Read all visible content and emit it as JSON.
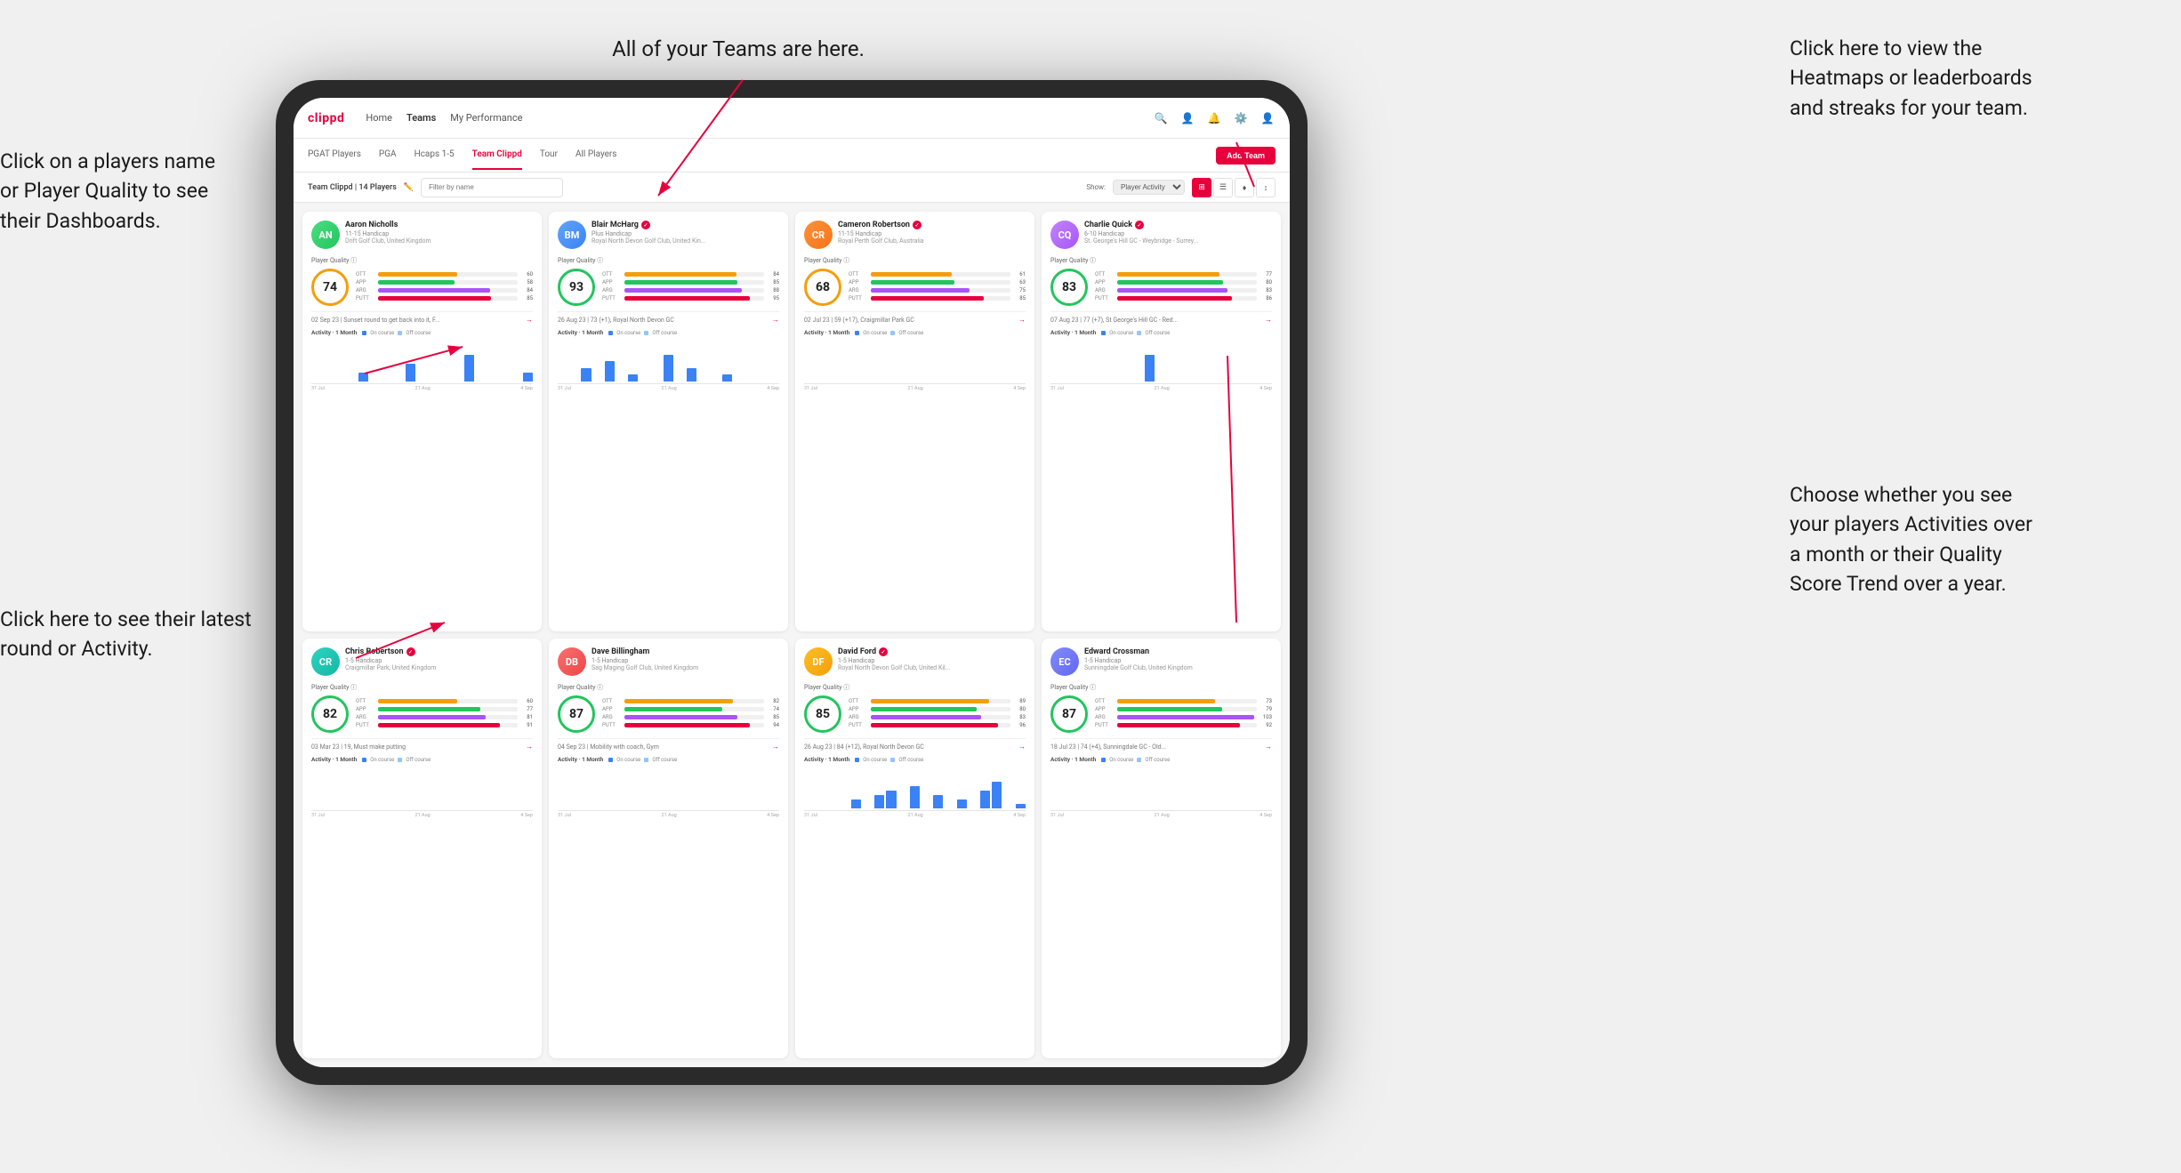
{
  "annotations": {
    "top_left": "Click on a players name\nor Player Quality to see\ntheir Dashboards.",
    "bottom_left": "Click here to see their latest\nround or Activity.",
    "top_center": "All of your Teams are here.",
    "top_right": "Click here to view the\nHeatmaps or leaderboards\nand streaks for your team.",
    "bottom_right": "Choose whether you see\nyour players Activities over\na month or their Quality\nScore Trend over a year."
  },
  "app": {
    "logo": "clippd",
    "nav": [
      "Home",
      "Teams",
      "My Performance"
    ],
    "tabs": [
      "PGAT Players",
      "PGA",
      "Hcaps 1-5",
      "Team Clippd",
      "Tour",
      "All Players"
    ],
    "active_tab": "Team Clippd",
    "team_label": "Team Clippd | 14 Players",
    "search_placeholder": "Filter by name",
    "show_label": "Show:",
    "show_option": "Player Activity",
    "add_team": "Add Team"
  },
  "players": [
    {
      "name": "Aaron Nicholls",
      "handicap": "11-15 Handicap",
      "club": "Drift Golf Club, United Kingdom",
      "quality": 74,
      "quality_level": "mid",
      "ott": 60,
      "app": 58,
      "arg": 84,
      "putt": 85,
      "recent": "02 Sep 23 | Sunset round to get back into it, F...",
      "avatar_color": "av-green",
      "initials": "AN",
      "chart_data": [
        0,
        0,
        0,
        0,
        1,
        0,
        0,
        0,
        2,
        0,
        0,
        0,
        0,
        3,
        0,
        0,
        0,
        0,
        1
      ]
    },
    {
      "name": "Blair McHarg",
      "handicap": "Plus Handicap",
      "club": "Royal North Devon Golf Club, United Kin...",
      "quality": 93,
      "quality_level": "high",
      "ott": 84,
      "app": 85,
      "arg": 88,
      "putt": 95,
      "recent": "26 Aug 23 | 73 (+1), Royal North Devon GC",
      "avatar_color": "av-blue",
      "initials": "BM",
      "chart_data": [
        0,
        0,
        2,
        0,
        3,
        0,
        1,
        0,
        0,
        4,
        0,
        2,
        0,
        0,
        1,
        0,
        0,
        0,
        0
      ]
    },
    {
      "name": "Cameron Robertson",
      "handicap": "11-15 Handicap",
      "club": "Royal Perth Golf Club, Australia",
      "quality": 68,
      "quality_level": "mid",
      "ott": 61,
      "app": 63,
      "arg": 75,
      "putt": 85,
      "recent": "02 Jul 23 | 59 (+17), Craigmillar Park GC",
      "avatar_color": "av-orange",
      "initials": "CR",
      "chart_data": [
        0,
        0,
        0,
        0,
        0,
        0,
        0,
        0,
        0,
        0,
        0,
        0,
        0,
        0,
        0,
        0,
        0,
        0,
        0
      ]
    },
    {
      "name": "Charlie Quick",
      "handicap": "6-10 Handicap",
      "club": "St. George's Hill GC - Weybridge - Surrey...",
      "quality": 83,
      "quality_level": "high",
      "ott": 77,
      "app": 80,
      "arg": 83,
      "putt": 86,
      "recent": "07 Aug 23 | 77 (+7), St George's Hill GC - Red...",
      "avatar_color": "av-purple",
      "initials": "CQ",
      "chart_data": [
        0,
        0,
        0,
        0,
        0,
        0,
        0,
        0,
        1,
        0,
        0,
        0,
        0,
        0,
        0,
        0,
        0,
        0,
        0
      ]
    },
    {
      "name": "Chris Robertson",
      "handicap": "1-5 Handicap",
      "club": "Craigmillar Park, United Kingdom",
      "quality": 82,
      "quality_level": "high",
      "ott": 60,
      "app": 77,
      "arg": 81,
      "putt": 91,
      "recent": "03 Mar 23 | 19, Must make putting",
      "avatar_color": "av-teal",
      "initials": "CR",
      "chart_data": [
        0,
        0,
        0,
        0,
        0,
        0,
        0,
        0,
        0,
        0,
        0,
        0,
        0,
        0,
        0,
        0,
        0,
        0,
        0
      ]
    },
    {
      "name": "Dave Billingham",
      "handicap": "1-5 Handicap",
      "club": "Sag Maging Golf Club, United Kingdom",
      "quality": 87,
      "quality_level": "high",
      "ott": 82,
      "app": 74,
      "arg": 85,
      "putt": 94,
      "recent": "04 Sep 23 | Mobility with coach, Gym",
      "avatar_color": "av-red",
      "initials": "DB",
      "chart_data": [
        0,
        0,
        0,
        0,
        0,
        0,
        0,
        0,
        0,
        0,
        0,
        0,
        0,
        0,
        0,
        0,
        0,
        0,
        0
      ]
    },
    {
      "name": "David Ford",
      "handicap": "1-5 Handicap",
      "club": "Royal North Devon Golf Club, United Kil...",
      "quality": 85,
      "quality_level": "high",
      "ott": 89,
      "app": 80,
      "arg": 83,
      "putt": 96,
      "recent": "26 Aug 23 | 84 (+12), Royal North Devon GC",
      "avatar_color": "av-yellow",
      "initials": "DF",
      "chart_data": [
        0,
        0,
        0,
        0,
        2,
        0,
        3,
        4,
        0,
        5,
        0,
        3,
        0,
        2,
        0,
        4,
        6,
        0,
        1
      ]
    },
    {
      "name": "Edward Crossman",
      "handicap": "1-5 Handicap",
      "club": "Sunningdale Golf Club, United Kingdom",
      "quality": 87,
      "quality_level": "high",
      "ott": 73,
      "app": 79,
      "arg": 103,
      "putt": 92,
      "recent": "18 Jul 23 | 74 (+4), Sunningdale GC - Old...",
      "avatar_color": "av-indigo",
      "initials": "EC",
      "chart_data": [
        0,
        0,
        0,
        0,
        0,
        0,
        0,
        0,
        0,
        0,
        0,
        0,
        0,
        0,
        0,
        0,
        0,
        0,
        0
      ]
    }
  ]
}
